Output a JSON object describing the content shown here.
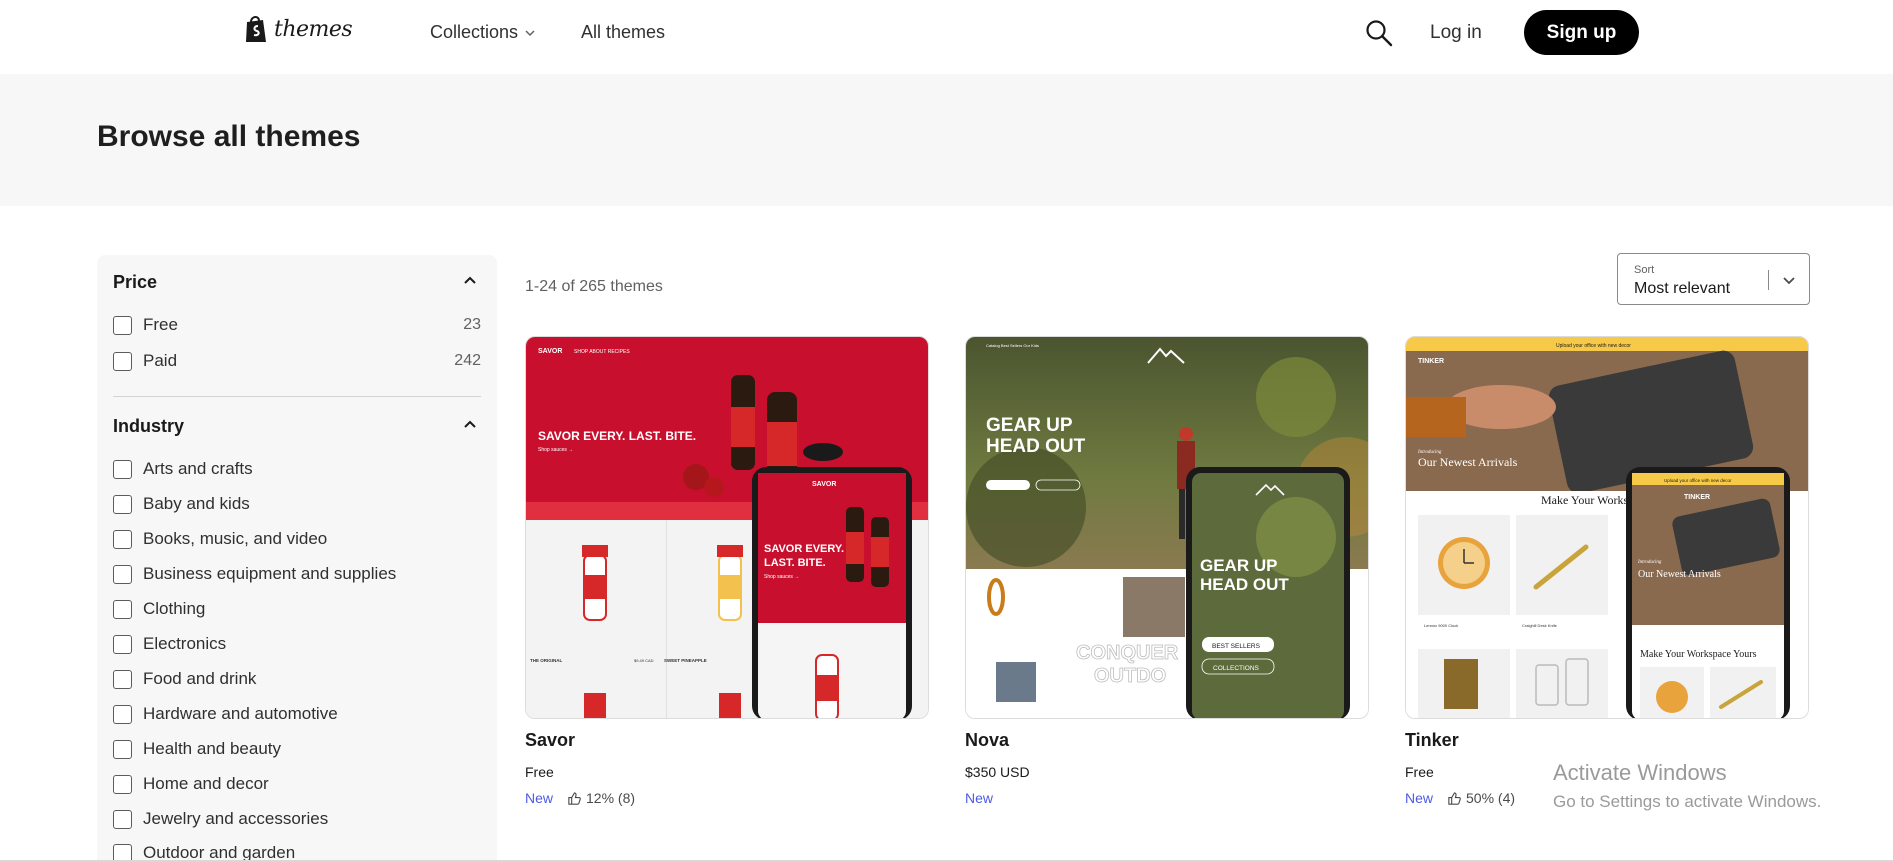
{
  "header": {
    "logo_text": "themes",
    "nav": {
      "collections": "Collections",
      "all_themes": "All themes"
    },
    "login": "Log in",
    "signup": "Sign up"
  },
  "hero": {
    "title": "Browse all themes"
  },
  "filters": {
    "price": {
      "title": "Price",
      "options": [
        {
          "label": "Free",
          "count": "23"
        },
        {
          "label": "Paid",
          "count": "242"
        }
      ]
    },
    "industry": {
      "title": "Industry",
      "options": [
        {
          "label": "Arts and crafts"
        },
        {
          "label": "Baby and kids"
        },
        {
          "label": "Books, music, and video"
        },
        {
          "label": "Business equipment and supplies"
        },
        {
          "label": "Clothing"
        },
        {
          "label": "Electronics"
        },
        {
          "label": "Food and drink"
        },
        {
          "label": "Hardware and automotive"
        },
        {
          "label": "Health and beauty"
        },
        {
          "label": "Home and decor"
        },
        {
          "label": "Jewelry and accessories"
        },
        {
          "label": "Outdoor and garden"
        }
      ]
    }
  },
  "results": {
    "count_text": "1-24 of 265 themes",
    "sort_label": "Sort",
    "sort_value": "Most relevant"
  },
  "themes": [
    {
      "name": "Savor",
      "price": "Free",
      "badge": "New",
      "rating": "12% (8)",
      "preview": {
        "brand": "SAVOR",
        "menu": "SHOP  ABOUT  RECIPES",
        "headline": "SAVOR EVERY. LAST. BITE.",
        "cta": "Shop sauces →",
        "mobile_headline_1": "SAVOR EVERY.",
        "mobile_headline_2": "LAST. BITE.",
        "product_1": "THE ORIGINAL",
        "product_2": "SWEET PINEAPPLE",
        "price_tag": "$9.49 CAD"
      }
    },
    {
      "name": "Nova",
      "price": "$350 USD",
      "badge": "New",
      "rating": "",
      "preview": {
        "menu": "Catalog   Best Sellers   Our Kids",
        "headline_1": "GEAR UP",
        "headline_2": "HEAD OUT",
        "btn_1": "BEST SELLERS",
        "btn_2": "COLLECTIONS",
        "section": "CONQUER",
        "section_2": "OUTDO"
      }
    },
    {
      "name": "Tinker",
      "price": "Free",
      "badge": "New",
      "rating": "50% (4)",
      "preview": {
        "announcement": "Upload your office with new decor",
        "brand": "TINKER",
        "kicker": "Introducing",
        "headline": "Our Newest Arrivals",
        "section": "Make Your Workspace Yours",
        "item_1": "Lennox 9000 Clock",
        "item_2": "Craighill Desk Knife"
      }
    }
  ],
  "watermark": {
    "line1": "Activate Windows",
    "line2": "Go to Settings to activate Windows."
  },
  "colors": {
    "accent": "#4d5be3",
    "savor_red": "#c8102e",
    "tinker_yellow": "#f7c948",
    "nova_green": "#5a6b3a"
  }
}
